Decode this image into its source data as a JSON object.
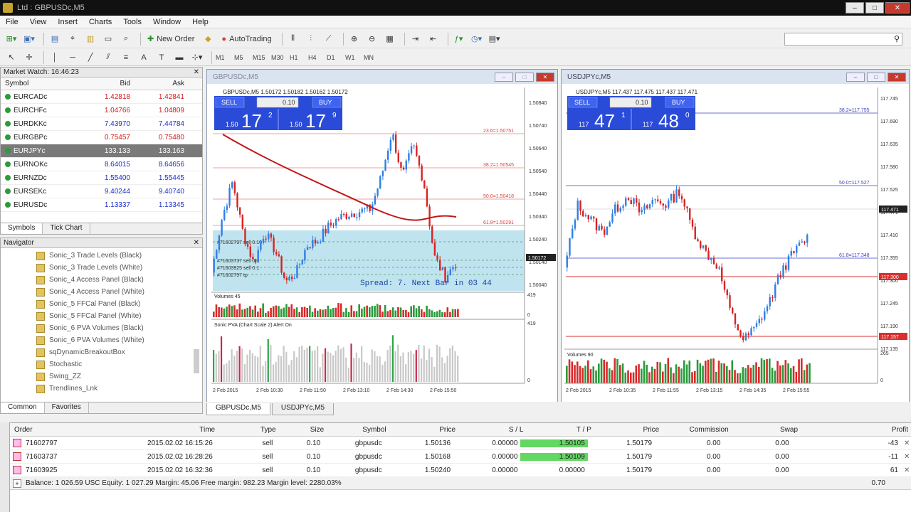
{
  "window": {
    "title": "  Ltd : GBPUSDc,M5"
  },
  "menu": [
    "File",
    "View",
    "Insert",
    "Charts",
    "Tools",
    "Window",
    "Help"
  ],
  "toolbar": {
    "new_order": "New Order",
    "autotrading": "AutoTrading",
    "timeframes": [
      "M1",
      "M5",
      "M15",
      "M30",
      "H1",
      "H4",
      "D1",
      "W1",
      "MN"
    ]
  },
  "market_watch": {
    "title": "Market Watch: 16:46:23",
    "columns": [
      "Symbol",
      "Bid",
      "Ask"
    ],
    "rows": [
      {
        "symbol": "EURCADc",
        "bid": "1.42818",
        "ask": "1.42841",
        "dir": "dn"
      },
      {
        "symbol": "EURCHFc",
        "bid": "1.04766",
        "ask": "1.04809",
        "dir": "dn"
      },
      {
        "symbol": "EURDKKc",
        "bid": "7.43970",
        "ask": "7.44784",
        "dir": "up"
      },
      {
        "symbol": "EURGBPc",
        "bid": "0.75457",
        "ask": "0.75480",
        "dir": "dn"
      },
      {
        "symbol": "EURJPYc",
        "bid": "133.133",
        "ask": "133.163",
        "dir": "sel"
      },
      {
        "symbol": "EURNOKc",
        "bid": "8.64015",
        "ask": "8.64656",
        "dir": "up"
      },
      {
        "symbol": "EURNZDc",
        "bid": "1.55400",
        "ask": "1.55445",
        "dir": "up"
      },
      {
        "symbol": "EURSEKc",
        "bid": "9.40244",
        "ask": "9.40740",
        "dir": "up"
      },
      {
        "symbol": "EURUSDc",
        "bid": "1.13337",
        "ask": "1.13345",
        "dir": "up"
      }
    ],
    "tabs": [
      "Symbols",
      "Tick Chart"
    ]
  },
  "navigator": {
    "title": "Navigator",
    "items": [
      "Sonic_3 Trade Levels (Black)",
      "Sonic_3 Trade Levels (White)",
      "Sonic_4 Access Panel (Black)",
      "Sonic_4 Access Panel (White)",
      "Sonic_5 FFCal Panel (Black)",
      "Sonic_5 FFCal Panel (White)",
      "Sonic_6 PVA Volumes (Black)",
      "Sonic_6 PVA Volumes (White)",
      "sqDynamicBreakoutBox",
      "Stochastic",
      "Swing_ZZ",
      "Trendlines_Lnk"
    ],
    "tabs": [
      "Common",
      "Favorites"
    ]
  },
  "chart_gbp": {
    "window_title": "GBPUSDc,M5",
    "info": "GBPUSDc,M5  1.50172 1.50182 1.50162 1.50172",
    "sell_label": "SELL",
    "buy_label": "BUY",
    "lot": "0.10",
    "sell_prefix": "1.50",
    "sell_big": "17",
    "sell_small": "2",
    "buy_prefix": "1.50",
    "buy_big": "17",
    "buy_small": "9",
    "price_labels": [
      "1.50840",
      "1.50740",
      "1.50640",
      "1.50540",
      "1.50440",
      "1.50340",
      "1.50240",
      "1.50140",
      "1.50040"
    ],
    "current_price": "1.50172",
    "fib_labels": [
      "23.6=1.50751",
      "38.2=1.50545",
      "50.0=1.50418",
      "61.8=1.50291"
    ],
    "spread_text": "Spread: 7.  Next Bar in 03 44",
    "volume_label": "Volumes 45",
    "volume_axis": [
      "419",
      "0"
    ],
    "pva_label": "Sonic PVA  (Chart Scale 2)   Alert On",
    "pva_axis": [
      "419",
      "0"
    ],
    "dates": [
      "2 Feb 2015",
      "2 Feb 10:30",
      "2 Feb 11:50",
      "2 Feb 13:10",
      "2 Feb 14:30",
      "2 Feb 15:50"
    ],
    "order_labels": [
      "#71602797 sell 0.10",
      "#71603737 sell 0.1",
      "#71603925 sell 0.1",
      "#71602797 tp"
    ]
  },
  "chart_jpy": {
    "window_title": "USDJPYc,M5",
    "info": "USDJPYc,M5  117.437 117.475 117.437 117.471",
    "sell_label": "SELL",
    "buy_label": "BUY",
    "lot": "0.10",
    "sell_prefix": "117",
    "sell_big": "47",
    "sell_small": "1",
    "buy_prefix": "117",
    "buy_big": "48",
    "buy_small": "0",
    "price_labels": [
      "117.745",
      "117.690",
      "117.635",
      "117.580",
      "117.525",
      "117.471",
      "117.410",
      "117.355",
      "117.300",
      "117.245",
      "117.190",
      "117.135"
    ],
    "current_price": "117.471",
    "red_prices": [
      "117.300",
      "117.157"
    ],
    "fib_labels": [
      "38.2=117.755",
      "50.0=117.527",
      "61.8=117.348"
    ],
    "volume_label": "Volumes 90",
    "volume_axis": [
      "265",
      "0"
    ],
    "dates": [
      "2 Feb 2015",
      "2 Feb 10:35",
      "2 Feb 11:55",
      "2 Feb 13:15",
      "2 Feb 14:35",
      "2 Feb 15:55"
    ]
  },
  "chart_tabs": [
    "GBPUSDc,M5",
    "USDJPYc,M5"
  ],
  "terminal": {
    "columns": [
      "Order",
      "Time",
      "Type",
      "Size",
      "Symbol",
      "Price",
      "S / L",
      "T / P",
      "Price",
      "Commission",
      "Swap",
      "Profit"
    ],
    "rows": [
      {
        "order": "71602797",
        "time": "2015.02.02 16:15:26",
        "type": "sell",
        "size": "0.10",
        "symbol": "gbpusdc",
        "price": "1.50136",
        "sl": "0.00000",
        "tp": "1.50105",
        "price2": "1.50179",
        "commission": "0.00",
        "swap": "0.00",
        "profit": "-43",
        "tp_hl": true
      },
      {
        "order": "71603737",
        "time": "2015.02.02 16:28:26",
        "type": "sell",
        "size": "0.10",
        "symbol": "gbpusdc",
        "price": "1.50168",
        "sl": "0.00000",
        "tp": "1.50109",
        "price2": "1.50179",
        "commission": "0.00",
        "swap": "0.00",
        "profit": "-11",
        "tp_hl": true
      },
      {
        "order": "71603925",
        "time": "2015.02.02 16:32:36",
        "type": "sell",
        "size": "0.10",
        "symbol": "gbpusdc",
        "price": "1.50240",
        "sl": "0.00000",
        "tp": "0.00000",
        "price2": "1.50179",
        "commission": "0.00",
        "swap": "0.00",
        "profit": "61",
        "tp_hl": false
      }
    ],
    "balance_text": "Balance: 1 026.59 USC   Equity: 1 027.29   Margin: 45.06   Free margin: 982.23   Margin level: 2280.03%",
    "balance_profit": "0.70"
  },
  "colors": {
    "bull": "#2f7fe6",
    "bear": "#d62424",
    "fib": "#e04040",
    "ma": "#c01818",
    "panel": "#2a4bd8",
    "box": "#bfe3ef"
  }
}
